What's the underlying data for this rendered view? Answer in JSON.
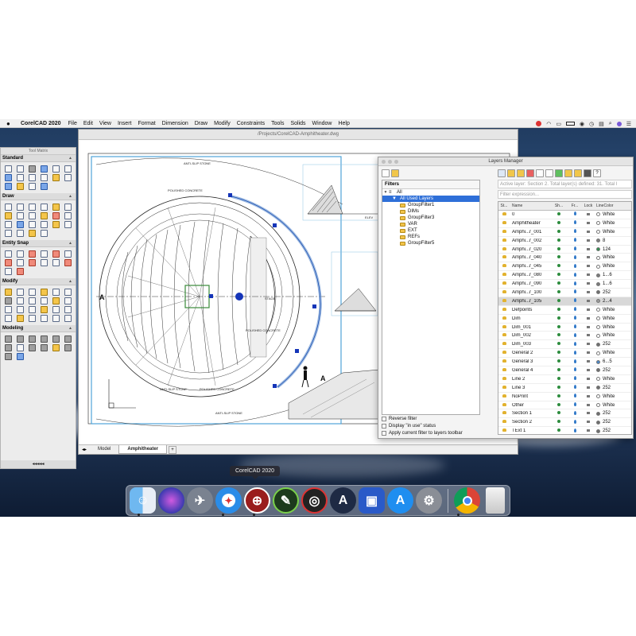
{
  "menubar": {
    "app": "CorelCAD 2020",
    "items": [
      "File",
      "Edit",
      "View",
      "Insert",
      "Format",
      "Dimension",
      "Draw",
      "Modify",
      "Constraints",
      "Tools",
      "Solids",
      "Window",
      "Help"
    ]
  },
  "toolmatrix": {
    "title": "Tool Matrix",
    "sections": [
      "Standard",
      "Draw",
      "Entity Snap",
      "Modify",
      "Modeling"
    ],
    "footer": "◂◂◂◂◂"
  },
  "drawing": {
    "title": "/Projects/CorelCAD-Amphitheater.dwg",
    "tabs": [
      "Model",
      "Amphitheater"
    ],
    "tab_add": "+",
    "labels": {
      "anti_slip_top": "ANTI-SLIP STONE",
      "polished_concrete_top": "POLISHED CONCRETE",
      "stage": "STAGE",
      "polished_concrete_right": "POLISHED CONCRETE",
      "anti_slip_bottom1": "ANTI-SLIP STONE",
      "polished_concrete_bottom": "POLISHED CONCRETE",
      "anti_slip_bottom2": "ANTI-SLIP STONE",
      "elevation": "ELEV",
      "marker_a": "A",
      "marker_a2": "A"
    }
  },
  "layers_manager": {
    "title": "Layers Manager",
    "filters_heading": "Filters",
    "filter_tree": [
      {
        "label": "All",
        "level": 0,
        "selected": false
      },
      {
        "label": "All Used Layers",
        "level": 1,
        "selected": true
      },
      {
        "label": "GroupFilter1",
        "level": 1,
        "selected": false
      },
      {
        "label": "DIMs",
        "level": 1,
        "selected": false
      },
      {
        "label": "GroupFilter3",
        "level": 1,
        "selected": false
      },
      {
        "label": "VAR",
        "level": 1,
        "selected": false
      },
      {
        "label": "EXT",
        "level": 1,
        "selected": false
      },
      {
        "label": "REFs",
        "level": 1,
        "selected": false
      },
      {
        "label": "GroupFilter5",
        "level": 1,
        "selected": false
      }
    ],
    "checkboxes": [
      "Reverse filter",
      "Display \"in use\" status",
      "Apply current filter to layers toolbar"
    ],
    "status": "Active layer: Section 2. Total layer(s) defined: 31. Total l",
    "filter_expression_placeholder": "Filter expression...",
    "columns": [
      "St...",
      "Name",
      "Sh...",
      "Fr...",
      "Lock",
      "LineColor"
    ],
    "rows": [
      {
        "name": "0",
        "color": "White",
        "swatch": "#ffffff"
      },
      {
        "name": "Amphitheater",
        "color": "White",
        "swatch": "#ffffff"
      },
      {
        "name": "Amphi...r_001",
        "color": "White",
        "swatch": "#ffffff"
      },
      {
        "name": "Amphi...r_002",
        "color": "8",
        "swatch": "#808080"
      },
      {
        "name": "Amphi...r_020",
        "color": "124",
        "swatch": "#2f8f4e"
      },
      {
        "name": "Amphi...r_040",
        "color": "White",
        "swatch": "#ffffff"
      },
      {
        "name": "Amphi...r_045",
        "color": "White",
        "swatch": "#ffffff"
      },
      {
        "name": "Amphi...r_080",
        "color": "1...6",
        "swatch": "#7a7a7a"
      },
      {
        "name": "Amphi...r_090",
        "color": "1...6",
        "swatch": "#7a7a7a"
      },
      {
        "name": "Amphi...r_100",
        "color": "252",
        "swatch": "#6e6e6e"
      },
      {
        "name": "Amphi...r_105",
        "color": "2...4",
        "swatch": "#9a9a9a",
        "selected": true
      },
      {
        "name": "Defpoints",
        "color": "White",
        "swatch": "#ffffff"
      },
      {
        "name": "Dim",
        "color": "White",
        "swatch": "#ffffff"
      },
      {
        "name": "Dim_001",
        "color": "White",
        "swatch": "#ffffff"
      },
      {
        "name": "Dim_002",
        "color": "White",
        "swatch": "#ffffff"
      },
      {
        "name": "Dim_003",
        "color": "252",
        "swatch": "#6e6e6e"
      },
      {
        "name": "General 2",
        "color": "White",
        "swatch": "#ffffff"
      },
      {
        "name": "General 3",
        "color": "6...5",
        "swatch": "#4a88c8"
      },
      {
        "name": "General 4",
        "color": "252",
        "swatch": "#6e6e6e"
      },
      {
        "name": "Line 2",
        "color": "White",
        "swatch": "#ffffff"
      },
      {
        "name": "Line 3",
        "color": "252",
        "swatch": "#6e6e6e"
      },
      {
        "name": "NoPrint",
        "color": "White",
        "swatch": "#ffffff"
      },
      {
        "name": "Other",
        "color": "White",
        "swatch": "#ffffff"
      },
      {
        "name": "Section 1",
        "color": "252",
        "swatch": "#6e6e6e"
      },
      {
        "name": "Section 2",
        "color": "252",
        "swatch": "#6e6e6e"
      },
      {
        "name": "TExt 1",
        "color": "252",
        "swatch": "#6e6e6e"
      }
    ]
  },
  "dock": {
    "tooltip": "CorelCAD 2020",
    "icons": [
      "finder-icon",
      "siri-icon",
      "launchpad-icon",
      "safari-icon",
      "corelcad-icon",
      "coreldraw-icon",
      "corel-capture-icon",
      "affinity-icon",
      "keynote-icon",
      "app-store-icon",
      "system-preferences-icon",
      "chrome-icon",
      "trash-icon"
    ]
  }
}
